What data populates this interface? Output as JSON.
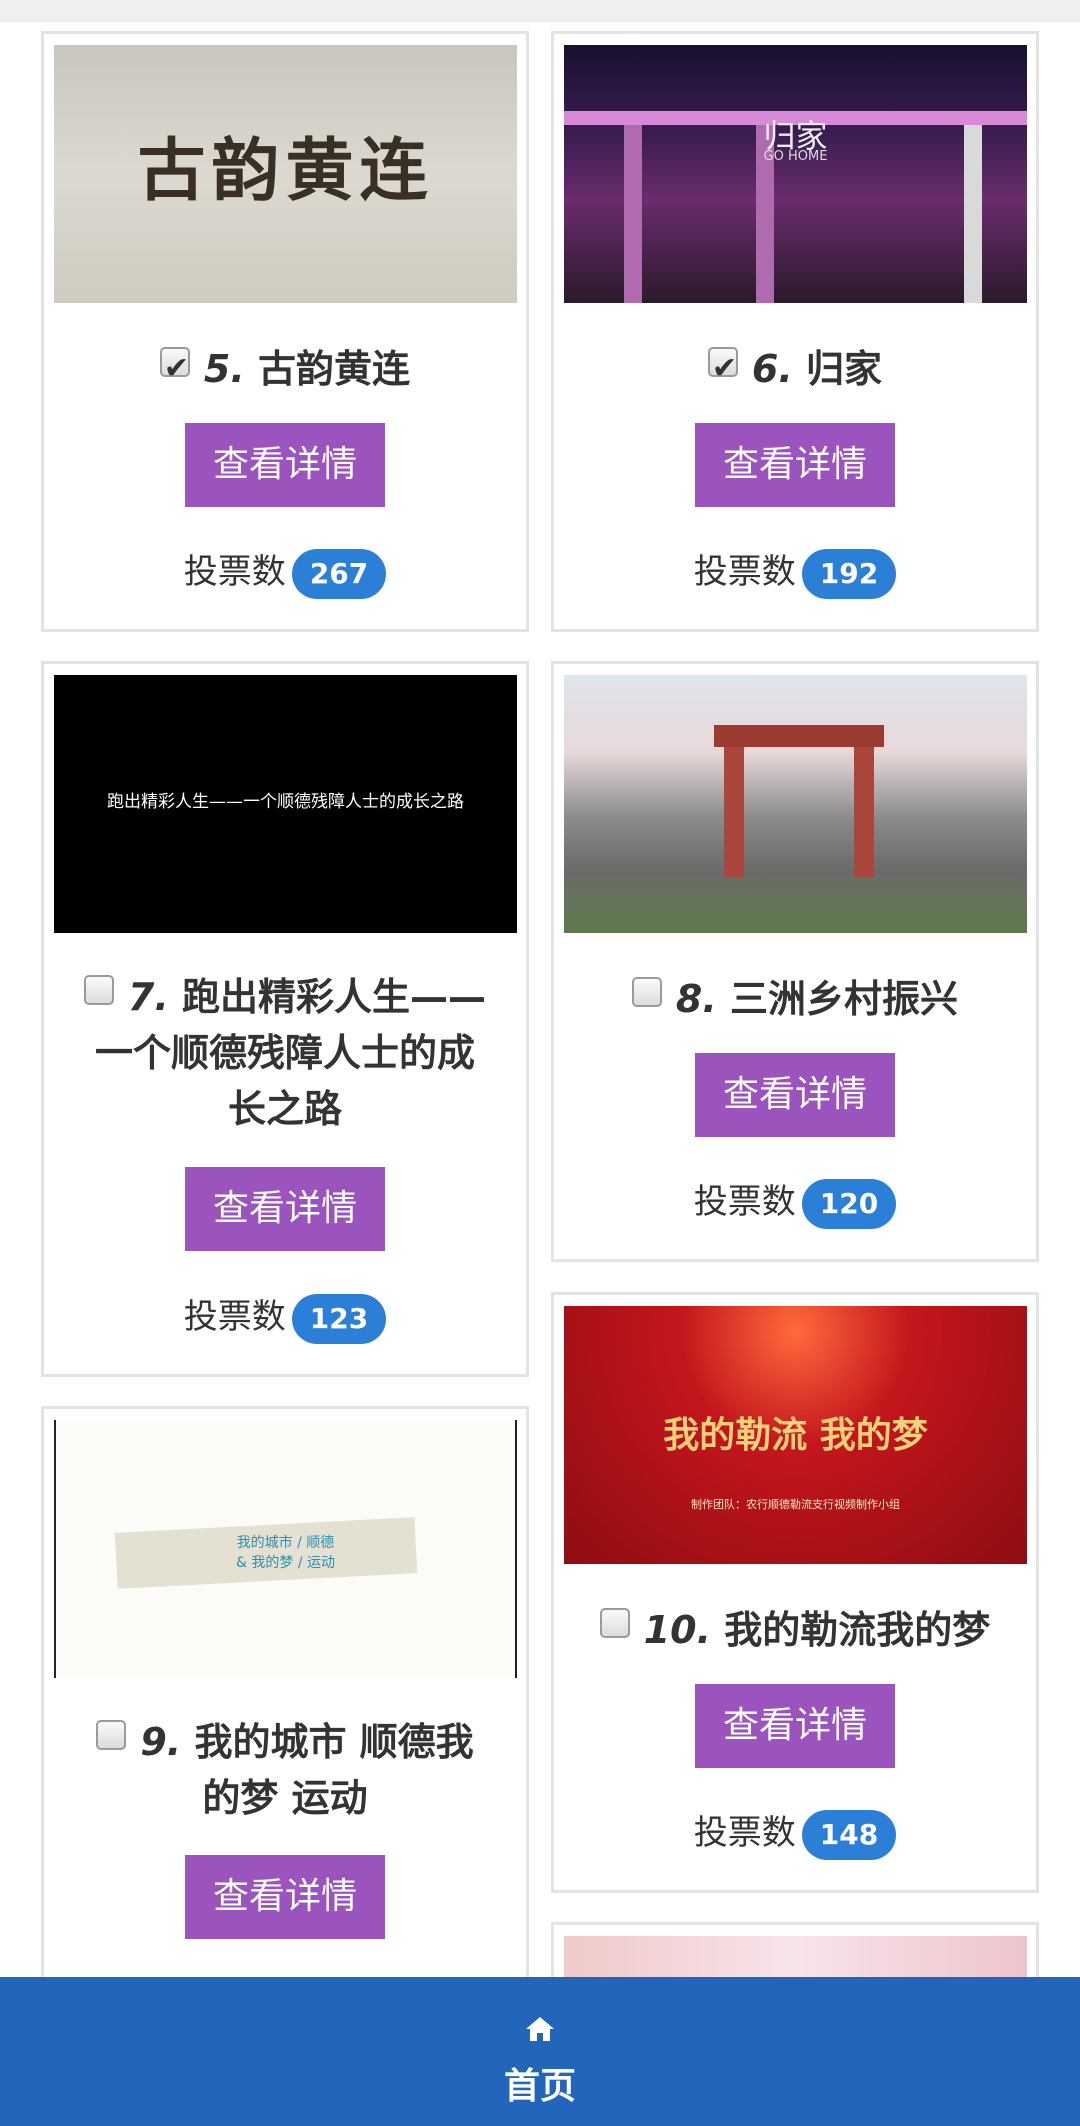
{
  "items": [
    {
      "num": "5.",
      "title": "古韵黄连",
      "checked": true,
      "button": "查看详情",
      "votes_label": "投票数",
      "votes": "267",
      "thumb_text": "古韵黄连"
    },
    {
      "num": "6.",
      "title": "归家",
      "checked": true,
      "button": "查看详情",
      "votes_label": "投票数",
      "votes": "192",
      "thumb_text": "归家",
      "thumb_sub": "GO HOME"
    },
    {
      "num": "7.",
      "title_lines": [
        "跑出精彩人生——",
        "一个顺德残障人士的成",
        "长之路"
      ],
      "checked": false,
      "button": "查看详情",
      "votes_label": "投票数",
      "votes": "123",
      "thumb_text": "跑出精彩人生——一个顺德残障人士的成长之路"
    },
    {
      "num": "8.",
      "title": "三洲乡村振兴",
      "checked": false,
      "button": "查看详情",
      "votes_label": "投票数",
      "votes": "120"
    },
    {
      "num": "9.",
      "title_lines": [
        "我的城市 顺德我",
        "的梦 运动"
      ],
      "checked": false,
      "button": "查看详情",
      "thumb_text1": "我的城市 / 顺德",
      "thumb_text2": "& 我的梦 / 运动"
    },
    {
      "num": "10.",
      "title": "我的勒流我的梦",
      "checked": false,
      "button": "查看详情",
      "votes_label": "投票数",
      "votes": "148",
      "thumb_text": "我的勒流 我的梦",
      "thumb_sub": "制作团队：农行顺德勒流支行视频制作小组"
    }
  ],
  "nav": {
    "home_label": "首页",
    "icon": "home-icon"
  }
}
